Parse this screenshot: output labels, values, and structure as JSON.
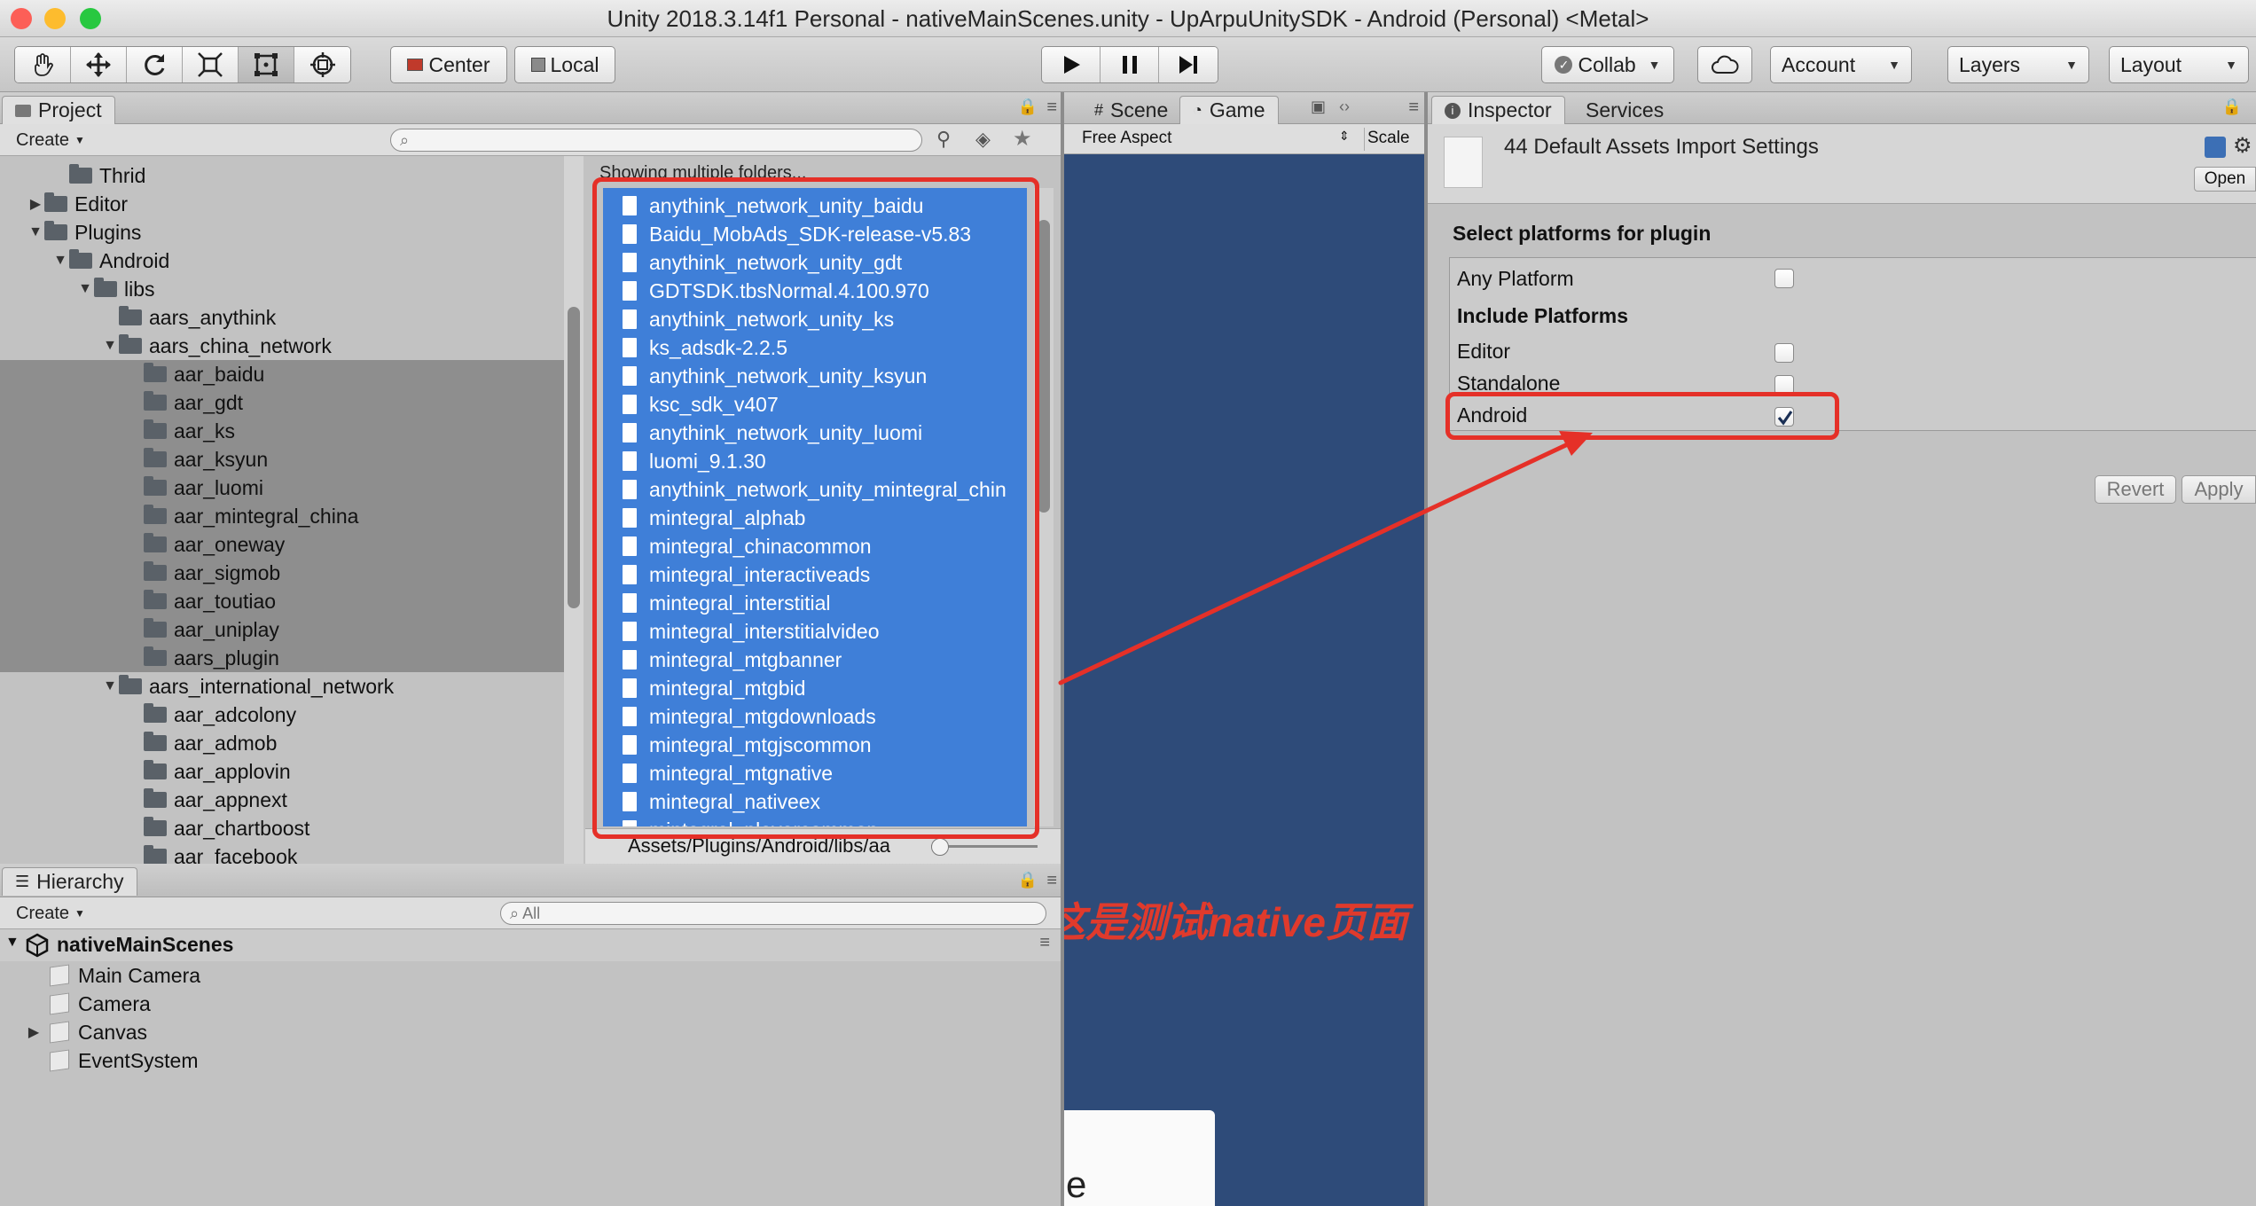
{
  "window": {
    "title": "Unity 2018.3.14f1 Personal - nativeMainScenes.unity - UpArpuUnitySDK - Android (Personal) <Metal>"
  },
  "toolbar": {
    "tools": [
      "hand-tool-icon",
      "move-tool-icon",
      "rotate-tool-icon",
      "scale-tool-icon",
      "rect-tool-icon",
      "transform-tool-icon"
    ],
    "pivot_label": "Center",
    "space_label": "Local",
    "collab_label": "Collab",
    "account_label": "Account",
    "layers_label": "Layers",
    "layout_label": "Layout"
  },
  "project": {
    "tab_label": "Project",
    "create_label": "Create",
    "search_placeholder": "",
    "tree": [
      {
        "label": "Thrid",
        "depth": 2,
        "arrow": "",
        "selected": false
      },
      {
        "label": "Editor",
        "depth": 1,
        "arrow": "▶",
        "selected": false
      },
      {
        "label": "Plugins",
        "depth": 1,
        "arrow": "▼",
        "selected": false
      },
      {
        "label": "Android",
        "depth": 2,
        "arrow": "▼",
        "selected": false
      },
      {
        "label": "libs",
        "depth": 3,
        "arrow": "▼",
        "selected": false
      },
      {
        "label": "aars_anythink",
        "depth": 4,
        "arrow": "",
        "selected": false
      },
      {
        "label": "aars_china_network",
        "depth": 4,
        "arrow": "▼",
        "selected": false
      },
      {
        "label": "aar_baidu",
        "depth": 5,
        "arrow": "",
        "selected": true
      },
      {
        "label": "aar_gdt",
        "depth": 5,
        "arrow": "",
        "selected": true
      },
      {
        "label": "aar_ks",
        "depth": 5,
        "arrow": "",
        "selected": true
      },
      {
        "label": "aar_ksyun",
        "depth": 5,
        "arrow": "",
        "selected": true
      },
      {
        "label": "aar_luomi",
        "depth": 5,
        "arrow": "",
        "selected": true
      },
      {
        "label": "aar_mintegral_china",
        "depth": 5,
        "arrow": "",
        "selected": true
      },
      {
        "label": "aar_oneway",
        "depth": 5,
        "arrow": "",
        "selected": true
      },
      {
        "label": "aar_sigmob",
        "depth": 5,
        "arrow": "",
        "selected": true
      },
      {
        "label": "aar_toutiao",
        "depth": 5,
        "arrow": "",
        "selected": true
      },
      {
        "label": "aar_uniplay",
        "depth": 5,
        "arrow": "",
        "selected": true
      },
      {
        "label": "aars_plugin",
        "depth": 5,
        "arrow": "",
        "selected": true
      },
      {
        "label": "aars_international_network",
        "depth": 4,
        "arrow": "▼",
        "selected": false
      },
      {
        "label": "aar_adcolony",
        "depth": 5,
        "arrow": "",
        "selected": false
      },
      {
        "label": "aar_admob",
        "depth": 5,
        "arrow": "",
        "selected": false
      },
      {
        "label": "aar_applovin",
        "depth": 5,
        "arrow": "",
        "selected": false
      },
      {
        "label": "aar_appnext",
        "depth": 5,
        "arrow": "",
        "selected": false
      },
      {
        "label": "aar_chartboost",
        "depth": 5,
        "arrow": "",
        "selected": false
      },
      {
        "label": "aar_facebook",
        "depth": 5,
        "arrow": "",
        "selected": false
      }
    ],
    "showing_text": "Showing multiple folders...",
    "files": [
      "anythink_network_unity_baidu",
      "Baidu_MobAds_SDK-release-v5.83",
      "anythink_network_unity_gdt",
      "GDTSDK.tbsNormal.4.100.970",
      "anythink_network_unity_ks",
      "ks_adsdk-2.2.5",
      "anythink_network_unity_ksyun",
      "ksc_sdk_v407",
      "anythink_network_unity_luomi",
      "luomi_9.1.30",
      "anythink_network_unity_mintegral_chin",
      "mintegral_alphab",
      "mintegral_chinacommon",
      "mintegral_interactiveads",
      "mintegral_interstitial",
      "mintegral_interstitialvideo",
      "mintegral_mtgbanner",
      "mintegral_mtgbid",
      "mintegral_mtgdownloads",
      "mintegral_mtgjscommon",
      "mintegral_mtgnative",
      "mintegral_nativeex",
      "mintegral_playercommon"
    ],
    "path_text": "Assets/Plugins/Android/libs/aa"
  },
  "hierarchy": {
    "tab_label": "Hierarchy",
    "create_label": "Create",
    "search_placeholder": "All",
    "scene_name": "nativeMainScenes",
    "items": [
      {
        "label": "Main Camera",
        "arrow": ""
      },
      {
        "label": "Camera",
        "arrow": ""
      },
      {
        "label": "Canvas",
        "arrow": "▶"
      },
      {
        "label": "EventSystem",
        "arrow": ""
      }
    ]
  },
  "game": {
    "scene_tab": "Scene",
    "game_tab": "Game",
    "aspect_label": "Free Aspect",
    "scale_label": "Scale",
    "overlay_text": "这是测试native页面",
    "bottom_text": "e"
  },
  "inspector": {
    "tab_label": "Inspector",
    "services_tab": "Services",
    "asset_title": "44 Default Assets Import Settings",
    "open_label": "Open",
    "section_title": "Select platforms for plugin",
    "any_platform_label": "Any Platform",
    "any_platform_checked": false,
    "include_label": "Include Platforms",
    "platforms": [
      {
        "label": "Editor",
        "checked": false
      },
      {
        "label": "Standalone",
        "checked": false
      },
      {
        "label": "Android",
        "checked": true
      }
    ],
    "revert_label": "Revert",
    "apply_label": "Apply"
  },
  "colors": {
    "selection_blue": "#3f7fd8",
    "annotation_red": "#e53028",
    "game_bg": "#2e4b79"
  }
}
